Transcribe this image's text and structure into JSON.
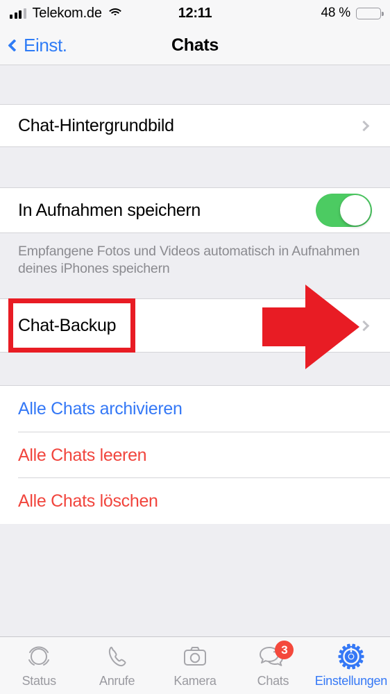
{
  "status_bar": {
    "carrier": "Telekom.de",
    "time": "12:11",
    "battery_percent": "48 %",
    "battery_level": 48,
    "battery_color": "#f6cc46",
    "signal_bars_filled": 3,
    "signal_bars_total": 4,
    "wifi": "wifi-icon"
  },
  "nav": {
    "back_label": "Einst.",
    "title": "Chats",
    "accent": "#2f7cf6"
  },
  "sections": {
    "wallpaper": {
      "rows": [
        {
          "label": "Chat-Hintergrundbild",
          "accessory": "chevron"
        }
      ]
    },
    "media": {
      "rows": [
        {
          "label": "In Aufnahmen speichern",
          "accessory": "toggle",
          "toggle_on": true
        }
      ],
      "footnote": "Empfangene Fotos und Videos automatisch in Aufnahmen deines iPhones speichern"
    },
    "backup": {
      "rows": [
        {
          "label": "Chat-Backup",
          "accessory": "chevron"
        }
      ]
    },
    "actions": {
      "rows": [
        {
          "label": "Alle Chats archivieren",
          "style": "blue"
        },
        {
          "label": "Alle Chats leeren",
          "style": "red"
        },
        {
          "label": "Alle Chats löschen",
          "style": "red"
        }
      ]
    }
  },
  "annotations": {
    "highlight_box": {
      "target": "Chat-Backup",
      "color": "#e81c24"
    },
    "arrow": {
      "direction": "right",
      "color": "#e81c24",
      "points_to": "Chat-Backup"
    }
  },
  "tabbar": {
    "items": [
      {
        "label": "Status",
        "icon": "status-icon",
        "active": false,
        "badge": null
      },
      {
        "label": "Anrufe",
        "icon": "phone-icon",
        "active": false,
        "badge": null
      },
      {
        "label": "Kamera",
        "icon": "camera-icon",
        "active": false,
        "badge": null
      },
      {
        "label": "Chats",
        "icon": "chats-icon",
        "active": false,
        "badge": "3"
      },
      {
        "label": "Einstellungen",
        "icon": "gear-icon",
        "active": true,
        "badge": null
      }
    ],
    "active_color": "#3478f6",
    "inactive_color": "#9a9aa0",
    "badge_color": "#f4493c"
  },
  "toggle_on_color": "#4ccb62"
}
